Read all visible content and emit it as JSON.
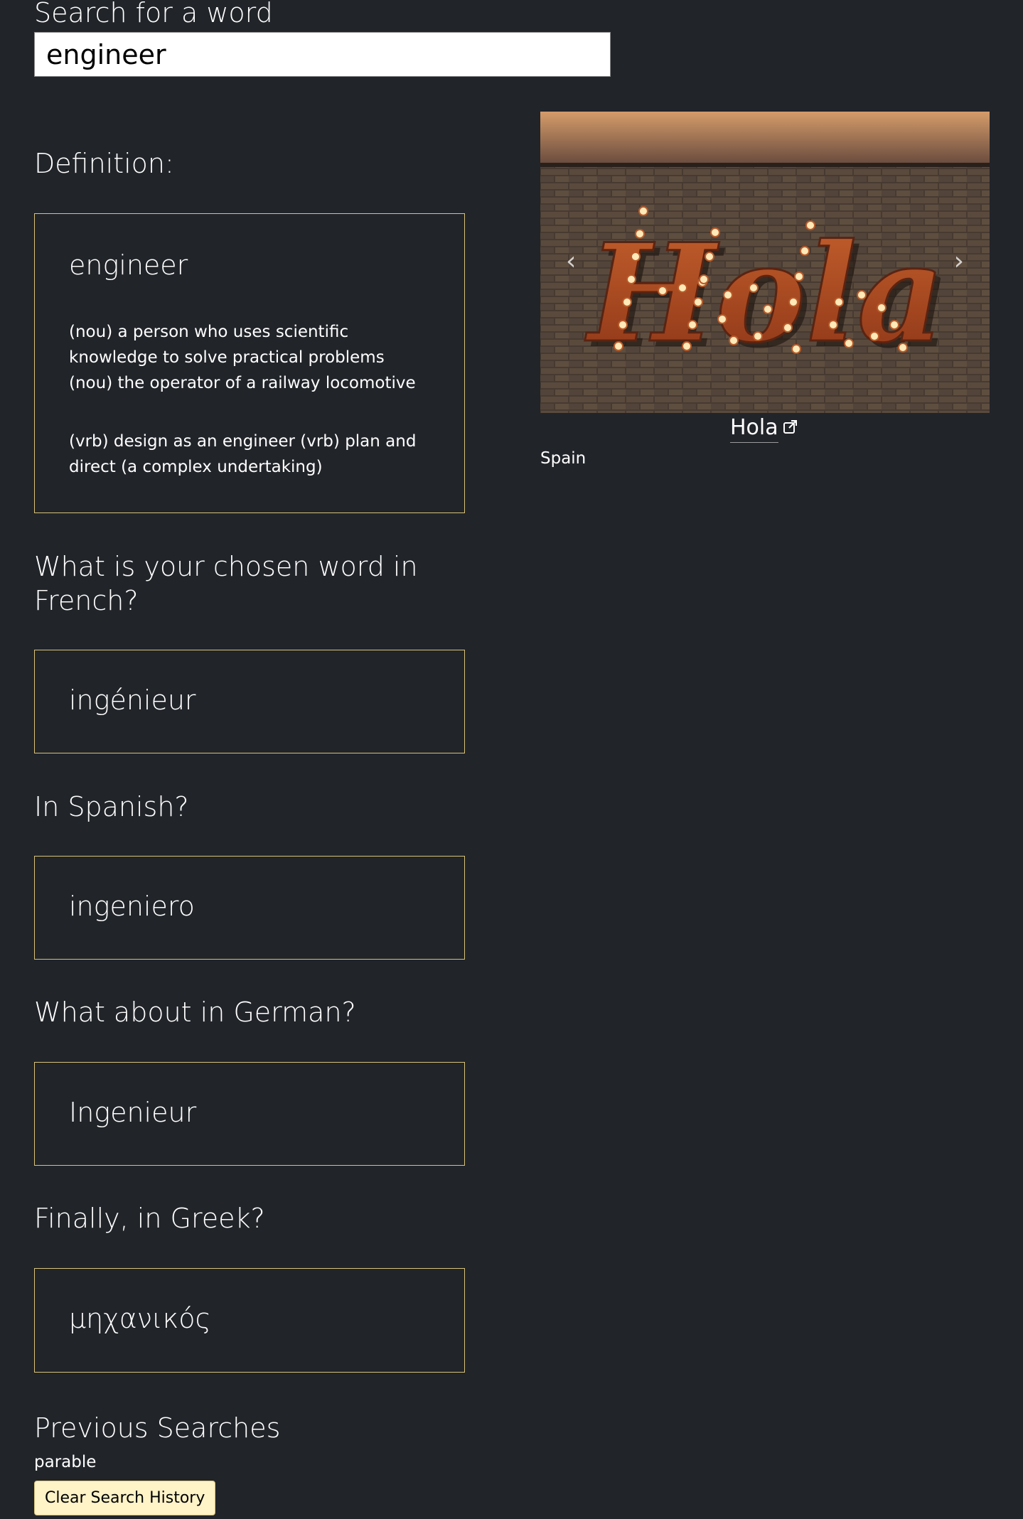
{
  "search": {
    "label": "Search for a word",
    "value": "engineer"
  },
  "definition": {
    "heading": "Definition:",
    "word": "engineer",
    "noun": "(nou) a person who uses scientific knowledge to solve practical problems (nou) the operator of a railway locomotive",
    "verb": "(vrb) design as an engineer (vrb) plan and direct (a complex undertaking)"
  },
  "translations": [
    {
      "question": "What is your chosen word in French?",
      "word": "ingénieur"
    },
    {
      "question": "In Spanish?",
      "word": "ingeniero"
    },
    {
      "question": "What about in German?",
      "word": "Ingenieur"
    },
    {
      "question": "Finally, in Greek?",
      "word": "μηχανικός"
    }
  ],
  "carousel": {
    "image_text": "Hola",
    "caption": "Hola",
    "country": "Spain",
    "prev_icon": "chevron-left-icon",
    "next_icon": "chevron-right-icon",
    "external_icon": "external-link-icon"
  },
  "history": {
    "heading": "Previous Searches",
    "items": [
      "parable"
    ],
    "clear_label": "Clear Search History"
  },
  "colors": {
    "background": "#212429",
    "card_border": "#d8c27a",
    "button_bg": "#fff3c8"
  }
}
